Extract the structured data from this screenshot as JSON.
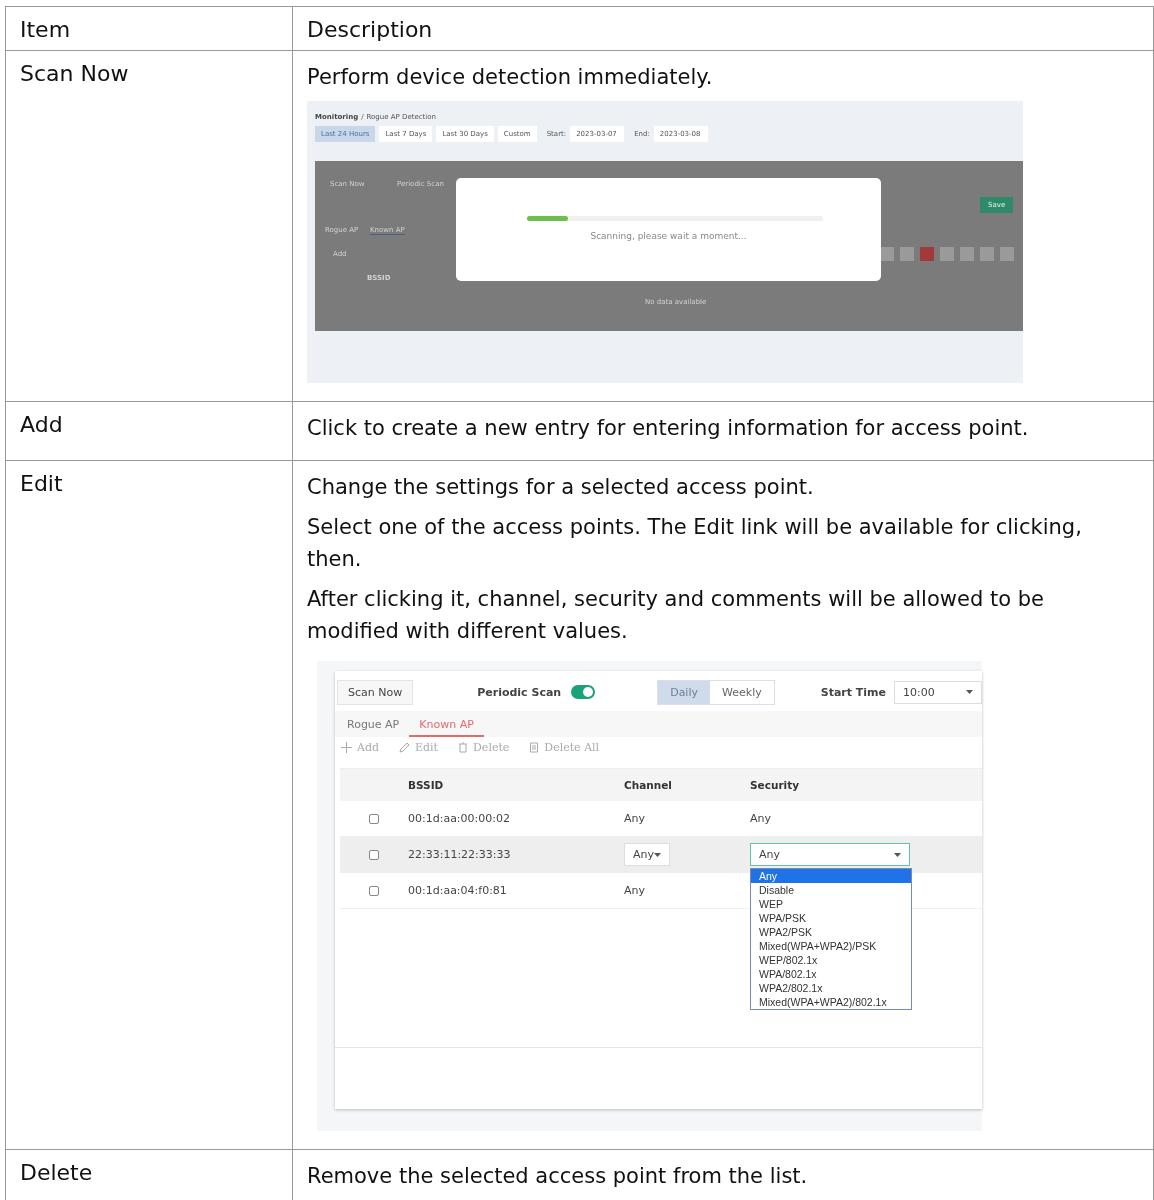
{
  "table": {
    "columns": [
      "Item",
      "Description"
    ],
    "rows": [
      {
        "item": "Scan Now",
        "paragraphs": [
          "Perform device detection immediately."
        ],
        "screenshot": {
          "kind": "scan_dialog",
          "breadcrumb": {
            "section": "Monitoring",
            "separator": "/",
            "page": "Rogue AP Detection"
          },
          "ranges": [
            {
              "label": "Last 24 Hours",
              "selected": true
            },
            {
              "label": "Last 7 Days",
              "selected": false
            },
            {
              "label": "Last 30 Days",
              "selected": false
            },
            {
              "label": "Custom",
              "selected": false
            }
          ],
          "start": {
            "label": "Start:",
            "value": "2023-03-07"
          },
          "end": {
            "label": "End:",
            "value": "2023-03-08"
          },
          "background": {
            "scan_button": "Scan Now",
            "periodic_label": "Periodic Scan",
            "tabs": [
              "Rogue AP",
              "Known AP"
            ],
            "add": "Add",
            "column": "BSSID",
            "empty": "No data available",
            "save": "Save"
          },
          "dialog": {
            "level": 0.14,
            "message": "Scanning, please wait a moment..."
          }
        }
      },
      {
        "item": "Add",
        "paragraphs": [
          "Click to create a new entry for entering information for access point."
        ]
      },
      {
        "item": "Edit",
        "paragraphs": [
          "Change the settings for a selected access point.",
          "Select one of the access points. The Edit link will be available for clicking, then.",
          "After clicking it, channel, security and comments will be allowed to be modified with different values."
        ],
        "screenshot": {
          "kind": "known_ap_edit",
          "scan_button": "Scan Now",
          "periodic": {
            "label": "Periodic Scan",
            "on": true
          },
          "frequency": [
            {
              "label": "Daily",
              "selected": true
            },
            {
              "label": "Weekly",
              "selected": false
            }
          ],
          "start_time": {
            "label": "Start Time",
            "value": "10:00"
          },
          "tabs": [
            {
              "label": "Rogue AP",
              "selected": false
            },
            {
              "label": "Known AP",
              "selected": true
            }
          ],
          "toolbar": [
            {
              "kind": "add",
              "label": "Add"
            },
            {
              "kind": "edit",
              "label": "Edit"
            },
            {
              "kind": "delete",
              "label": "Delete"
            },
            {
              "kind": "delete_all",
              "label": "Delete All"
            }
          ],
          "columns": [
            "BSSID",
            "Channel",
            "Security"
          ],
          "rows": [
            {
              "checked": false,
              "editing": false,
              "bssid": "00:1d:aa:00:00:02",
              "channel": "Any",
              "security": "Any"
            },
            {
              "checked": false,
              "editing": true,
              "bssid": "22:33:11:22:33:33",
              "channel": "Any",
              "security": "Any"
            },
            {
              "checked": false,
              "editing": false,
              "bssid": "00:1d:aa:04:f0:81",
              "channel": "Any"
            }
          ],
          "security_options": [
            {
              "label": "Any",
              "selected": true
            },
            {
              "label": "Disable",
              "selected": false
            },
            {
              "label": "WEP",
              "selected": false
            },
            {
              "label": "WPA/PSK",
              "selected": false
            },
            {
              "label": "WPA2/PSK",
              "selected": false
            },
            {
              "label": "Mixed(WPA+WPA2)/PSK",
              "selected": false
            },
            {
              "label": "WEP/802.1x",
              "selected": false
            },
            {
              "label": "WPA/802.1x",
              "selected": false
            },
            {
              "label": "WPA2/802.1x",
              "selected": false
            },
            {
              "label": "Mixed(WPA+WPA2)/802.1x",
              "selected": false
            }
          ]
        }
      },
      {
        "item": "Delete",
        "paragraphs": [
          "Remove the selected access point from the list."
        ]
      }
    ]
  }
}
